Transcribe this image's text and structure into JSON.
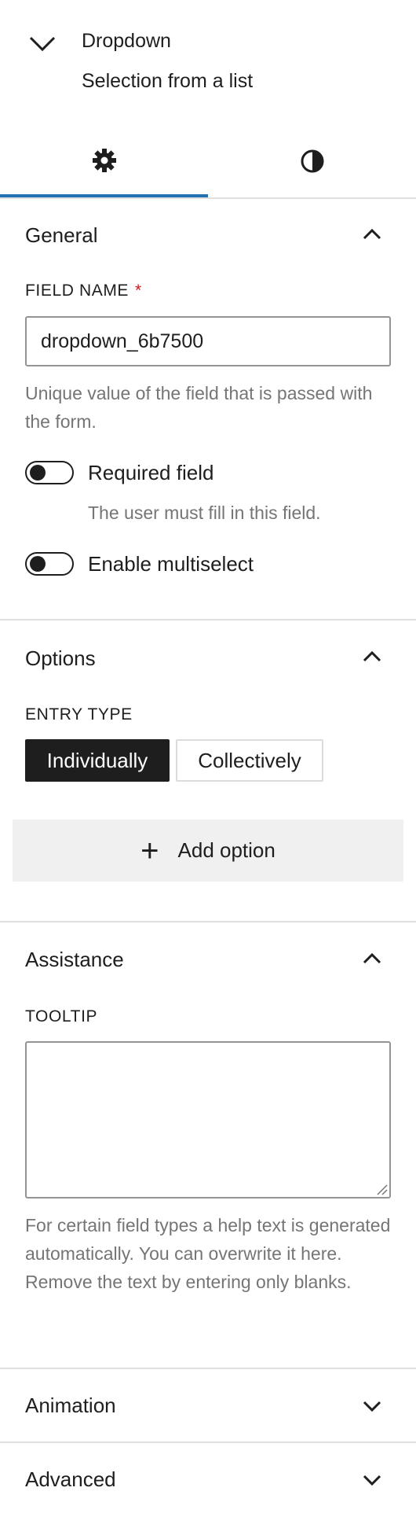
{
  "block": {
    "title": "Dropdown",
    "description": "Selection from a list"
  },
  "tabs": [
    {
      "icon": "gear-icon",
      "active": true
    },
    {
      "icon": "contrast-icon",
      "active": false
    }
  ],
  "general": {
    "title": "General",
    "field_name_label": "FIELD NAME",
    "required_star": "*",
    "field_name_value": "dropdown_6b7500",
    "field_name_help": "Unique value of the field that is passed with the form.",
    "required_toggle_label": "Required field",
    "required_toggle_help": "The user must fill in this field.",
    "multiselect_toggle_label": "Enable multiselect"
  },
  "options": {
    "title": "Options",
    "entry_type_label": "ENTRY TYPE",
    "entry_types": [
      "Individually",
      "Collectively"
    ],
    "selected_entry_type": "Individually",
    "add_option_label": "Add option"
  },
  "assistance": {
    "title": "Assistance",
    "tooltip_label": "TOOLTIP",
    "tooltip_value": "",
    "tooltip_help": "For certain field types a help text is generated automatically. You can overwrite it here. Remove the text by entering only blanks."
  },
  "animation": {
    "title": "Animation"
  },
  "advanced": {
    "title": "Advanced"
  },
  "colors": {
    "accent": "#2271b1",
    "required": "#cc1818"
  }
}
